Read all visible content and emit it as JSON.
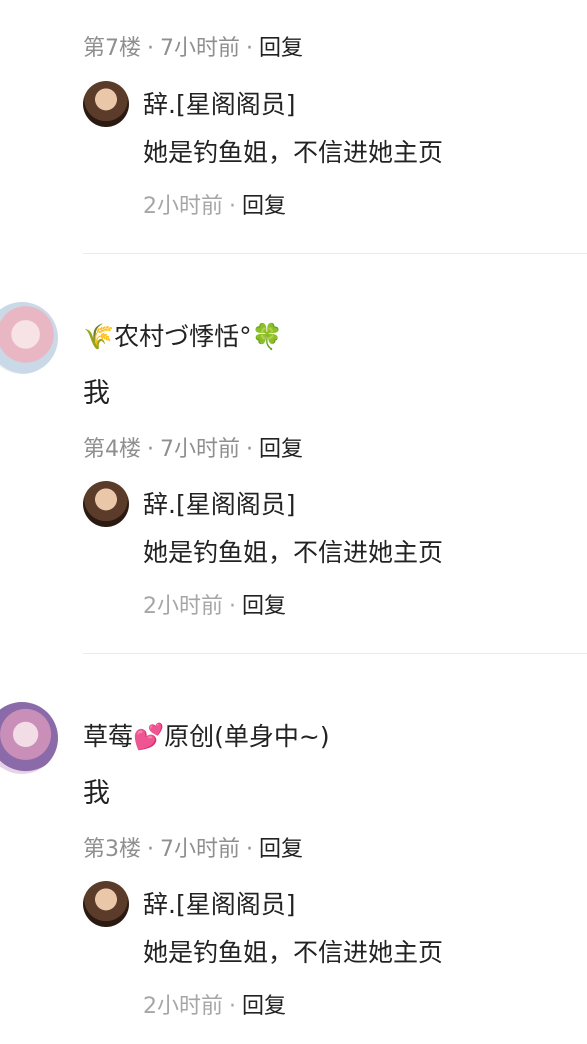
{
  "top_meta": {
    "floor": "第7楼",
    "time": "7小时前",
    "reply": "回复"
  },
  "threads": [
    {
      "sub_reply": {
        "name": "辞.[星阁阁员]",
        "text": "她是钓鱼姐，不信进她主页",
        "time": "2小时前",
        "reply": "回复"
      }
    },
    {
      "user": {
        "name_prefix": "🌾",
        "name": "农村づ悸恬°",
        "name_suffix": "🍀"
      },
      "text": "我",
      "floor": "第4楼",
      "time": "7小时前",
      "reply": "回复",
      "sub_reply": {
        "name": "辞.[星阁阁员]",
        "text": "她是钓鱼姐，不信进她主页",
        "time": "2小时前",
        "reply": "回复"
      }
    },
    {
      "user": {
        "name_prefix": "草莓",
        "name_emoji": "💕",
        "name": "原创(单身中~)"
      },
      "text": "我",
      "floor": "第3楼",
      "time": "7小时前",
      "reply": "回复",
      "sub_reply": {
        "name": "辞.[星阁阁员]",
        "text": "她是钓鱼姐，不信进她主页",
        "time": "2小时前",
        "reply": "回复"
      }
    }
  ],
  "separator": "·"
}
